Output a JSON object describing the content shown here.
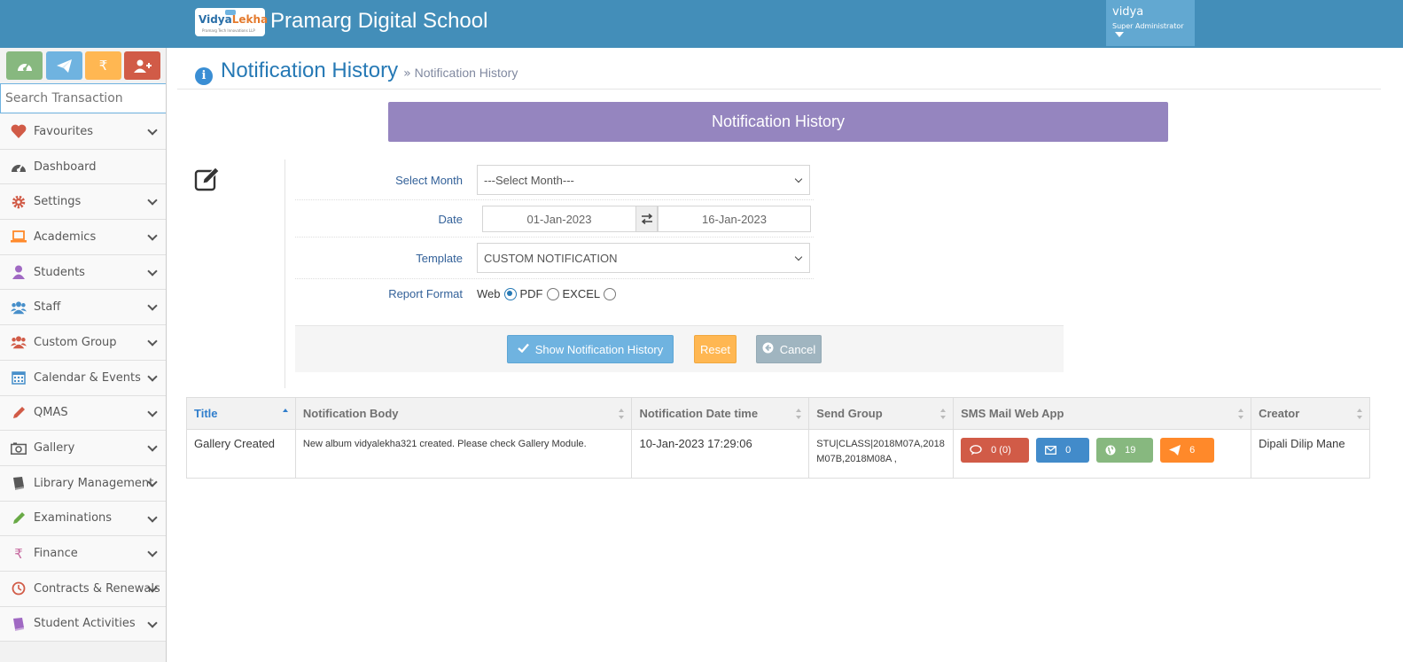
{
  "header": {
    "logo_text_a": "Vidya",
    "logo_text_b": "Lekha",
    "logo_subtext": "Pramarg Tech Innovations LLP",
    "school_name": "Pramarg Digital School",
    "user_name": "vidya",
    "user_role": "Super Administrator"
  },
  "sidebar": {
    "quick_buttons": [
      {
        "icon": "tachometer-icon",
        "color": "#87b87f"
      },
      {
        "icon": "paper-plane-icon",
        "color": "#6fb3e0"
      },
      {
        "icon": "rupee-icon",
        "color": "#ffb752",
        "glyph": "₹"
      },
      {
        "icon": "user-plus-icon",
        "color": "#d15b47"
      }
    ],
    "search_placeholder": "Search Transaction",
    "items": [
      {
        "label": "Favourites",
        "icon": "heart-icon",
        "color": "#d15b47"
      },
      {
        "label": "Dashboard",
        "icon": "tachometer-icon",
        "color": "#585858"
      },
      {
        "label": "Settings",
        "icon": "gear-icon",
        "color": "#d15b47"
      },
      {
        "label": "Academics",
        "icon": "laptop-icon",
        "color": "#ff892a"
      },
      {
        "label": "Students",
        "icon": "user-icon",
        "color": "#a069c3"
      },
      {
        "label": "Staff",
        "icon": "users-icon",
        "color": "#478fca"
      },
      {
        "label": "Custom Group",
        "icon": "group-icon",
        "color": "#d15b47"
      },
      {
        "label": "Calendar & Events",
        "icon": "calendar-icon",
        "color": "#478fca"
      },
      {
        "label": "QMAS",
        "icon": "pencil-icon",
        "color": "#d15b47"
      },
      {
        "label": "Gallery",
        "icon": "camera-icon",
        "color": "#585858"
      },
      {
        "label": "Library Management",
        "icon": "book-icon",
        "color": "#585858"
      },
      {
        "label": "Examinations",
        "icon": "pencil-icon",
        "color": "#69aa46"
      },
      {
        "label": "Finance",
        "icon": "rupee-icon",
        "color": "#c6699f",
        "glyph": "₹"
      },
      {
        "label": "Contracts & Renewals",
        "icon": "clock-icon",
        "color": "#d15b47"
      },
      {
        "label": "Student Activities",
        "icon": "book-icon",
        "color": "#a069c3"
      }
    ]
  },
  "page": {
    "title": "Notification History",
    "breadcrumb_sep": "»",
    "breadcrumb": "Notification History",
    "banner": "Notification History"
  },
  "form": {
    "month_label": "Select Month",
    "month_value": "---Select Month---",
    "date_label": "Date",
    "date_from": "01-Jan-2023",
    "date_to": "16-Jan-2023",
    "template_label": "Template",
    "template_value": "CUSTOM NOTIFICATION",
    "format_label": "Report Format",
    "format_options": [
      "Web",
      "PDF",
      "EXCEL"
    ],
    "format_selected": "Web",
    "show_button": "Show Notification History",
    "reset_button": "Reset",
    "cancel_button": "Cancel"
  },
  "table": {
    "columns": [
      "Title",
      "Notification Body",
      "Notification Date time",
      "Send Group",
      "SMS Mail Web App",
      "Creator"
    ],
    "rows": [
      {
        "title": "Gallery Created",
        "body": "New album vidyalekha321 created. Please check Gallery Module.",
        "datetime": "10-Jan-2023 17:29:06",
        "send_group": "STU|CLASS|2018M07A,2018M07B,2018M08A ,",
        "sms": "0 (0)",
        "mail": "0",
        "web": "19",
        "app": "6",
        "creator": "Dipali Dilip Mane"
      }
    ]
  }
}
